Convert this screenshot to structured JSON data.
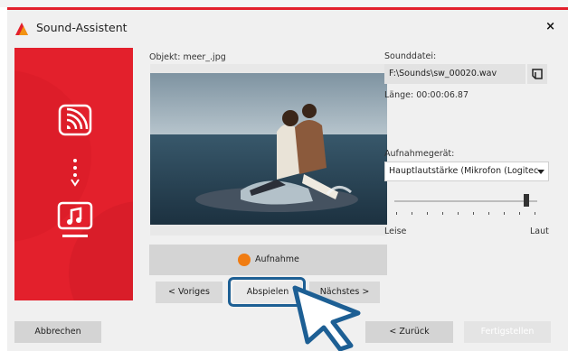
{
  "window": {
    "title": "Sound-Assistent",
    "close_label": "×"
  },
  "colors": {
    "brand_red": "#e3202c",
    "record_orange": "#f07c12",
    "highlight_blue": "#1d5f94"
  },
  "left": {
    "object_label": "Objekt: meer_.jpg",
    "photo_icon": "beach-couple-photo",
    "record_label": "Aufnahme",
    "prev_label": "< Voriges",
    "play_label": "Abspielen",
    "next_label": "Nächstes >"
  },
  "right": {
    "sound_label": "Sounddatei:",
    "sound_file": "F:\\Sounds\\sw_00020.wav",
    "length_label": "Länge: 00:00:06.87",
    "device_label": "Aufnahmegerät:",
    "device_value": "Hauptlautstärke (Mikrofon (Logitec",
    "volume_fraction": 0.94,
    "volume_min_label": "Leise",
    "volume_max_label": "Laut"
  },
  "footer": {
    "cancel_label": "Abbrechen",
    "back_label": "< Zurück",
    "finish_label": "Fertigstellen"
  },
  "icons": [
    "app-icon",
    "wireless-media-icon",
    "music-monitor-icon",
    "folder-icon",
    "pointer-cursor-icon",
    "close-icon"
  ]
}
